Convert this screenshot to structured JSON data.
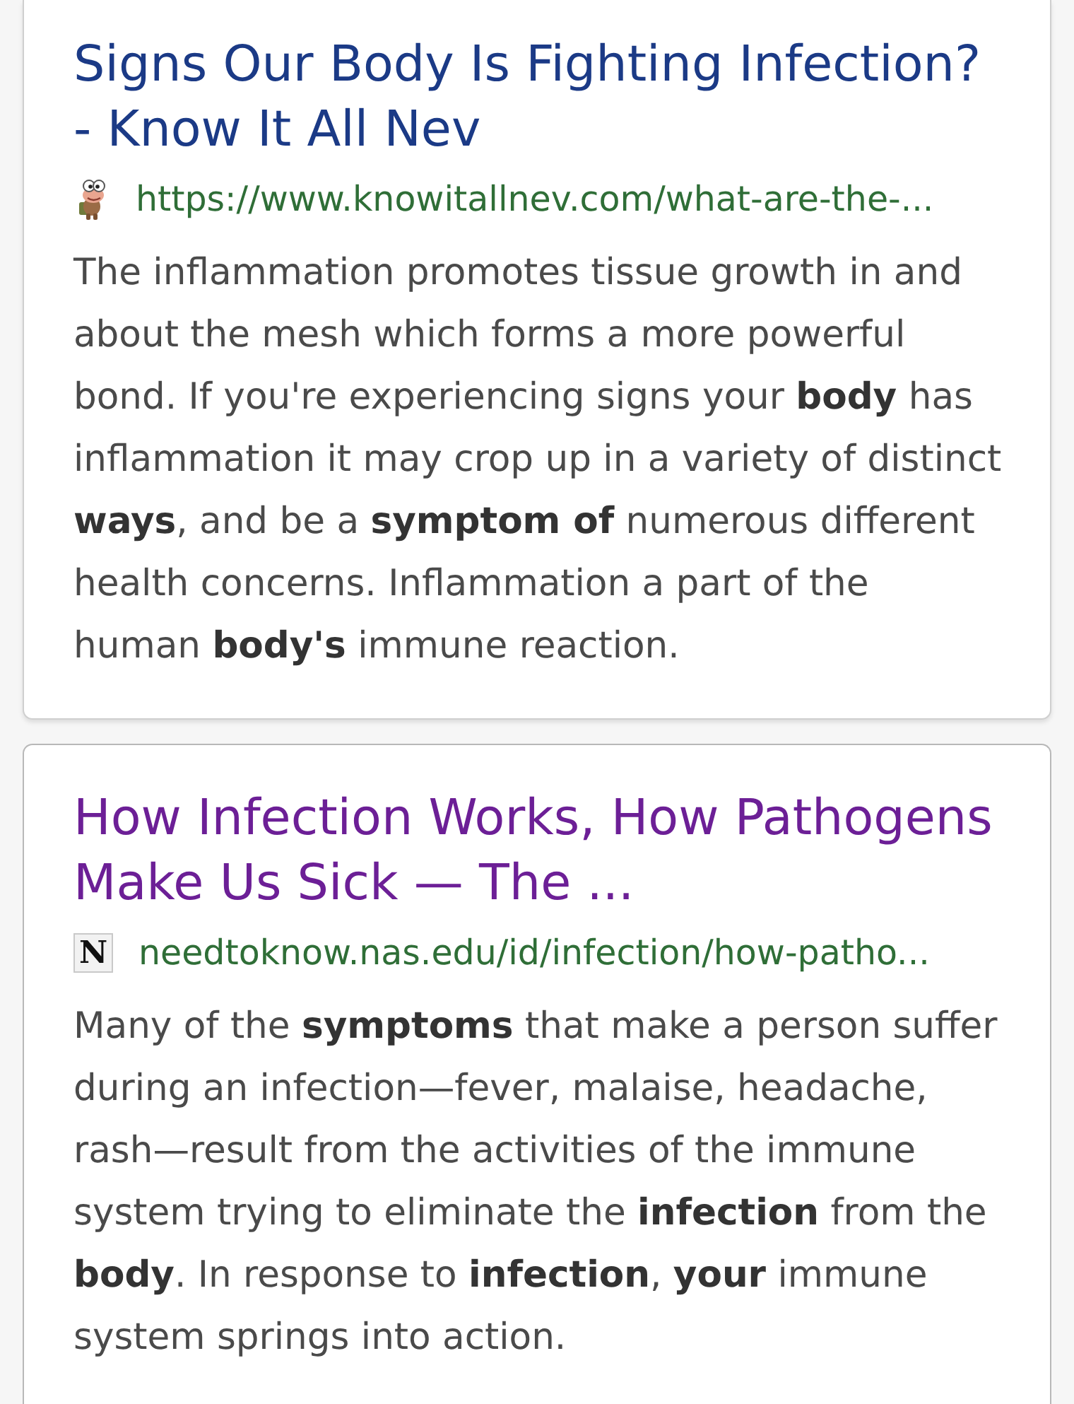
{
  "results": [
    {
      "title": "Signs Our Body Is Fighting Infection? - Know It All Nev",
      "visited": false,
      "favicon": {
        "kind": "cartoon"
      },
      "url": "https://www.knowitallnev.com/what-are-the-...",
      "snippet": "The inflammation promotes tissue growth in and about the mesh which forms a more powerful bond. If you're experiencing signs your **body** has inflammation it may crop up in a variety of distinct **ways**, and be a **symptom of** numerous different health concerns. Inflammation a part of the human **body's** immune reaction."
    },
    {
      "title": "How Infection Works, How Pathogens Make Us Sick — The ...",
      "visited": true,
      "favicon": {
        "kind": "letter",
        "text": "N"
      },
      "url": "needtoknow.nas.edu/id/infection/how-patho...",
      "snippet": "Many of the **symptoms** that make a person suffer during an infection—fever, malaise, headache, rash—result from the activities of the immune system trying to eliminate the **infection** from the **body**. In response to **infection**, **your** immune system springs into action."
    }
  ]
}
